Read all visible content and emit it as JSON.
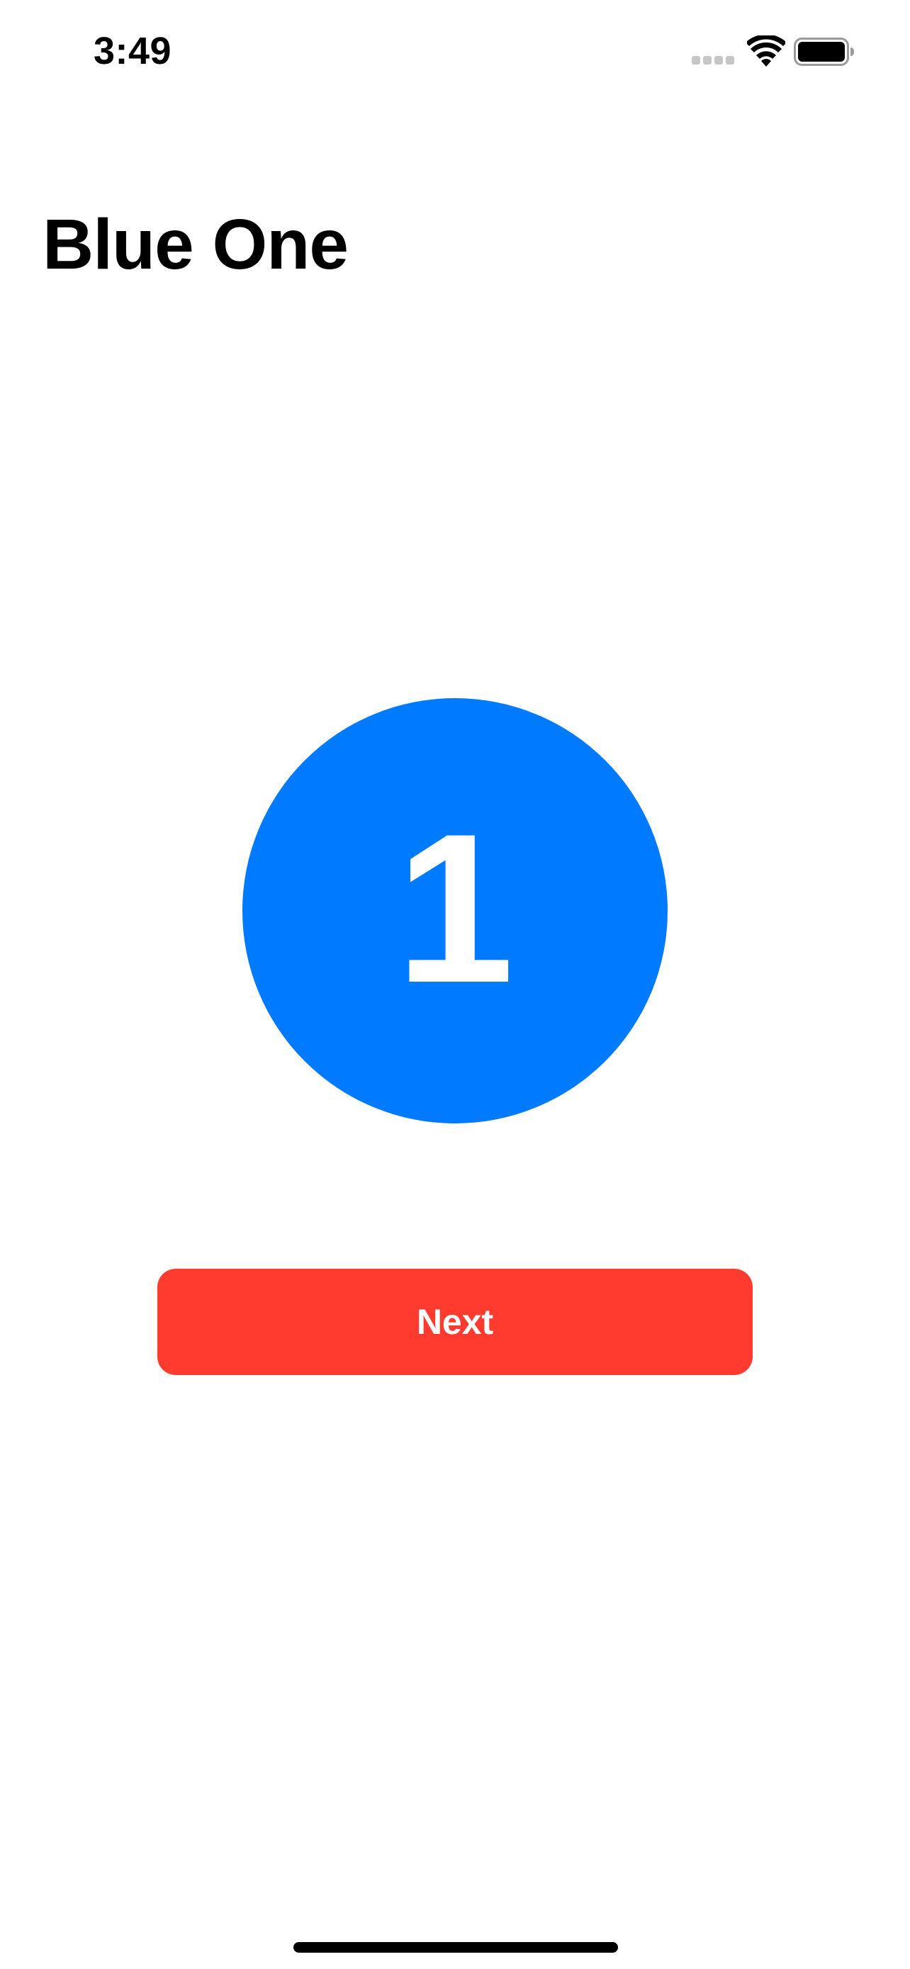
{
  "status_bar": {
    "time": "3:49",
    "icons": [
      "signal-dots-icon",
      "wifi-icon",
      "battery-icon"
    ]
  },
  "navigation": {
    "title": "Blue One"
  },
  "main": {
    "circle_number": "1",
    "circle_color": "#007aff",
    "next_button_label": "Next",
    "next_button_color": "#ff3b30"
  }
}
